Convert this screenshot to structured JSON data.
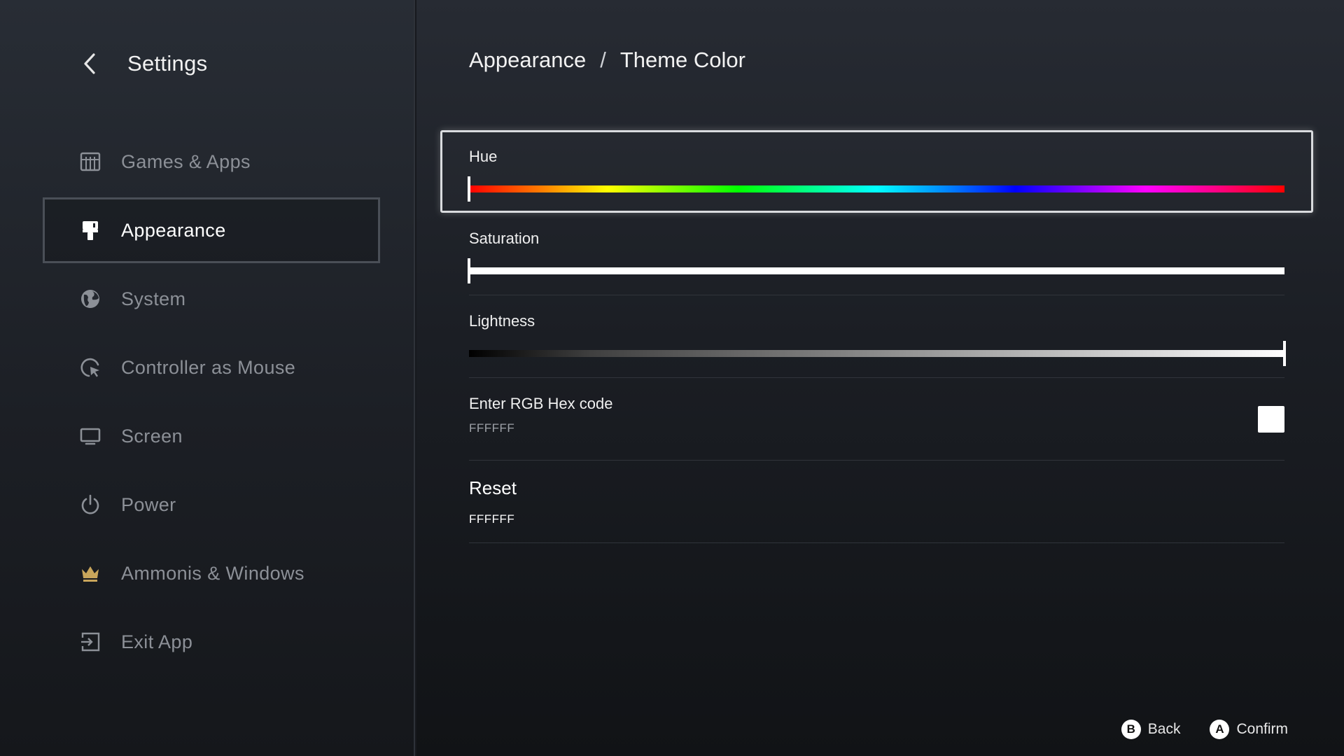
{
  "sidebar": {
    "title": "Settings",
    "back_icon": "chevron-left-icon",
    "items": [
      {
        "label": "Games  &  Apps",
        "icon": "games-grid-icon",
        "active": false
      },
      {
        "label": "Appearance",
        "icon": "paint-roller-icon",
        "active": true
      },
      {
        "label": "System",
        "icon": "globe-icon",
        "active": false
      },
      {
        "label": "Controller as Mouse",
        "icon": "cursor-icon",
        "active": false
      },
      {
        "label": "Screen",
        "icon": "monitor-icon",
        "active": false
      },
      {
        "label": "Power",
        "icon": "power-icon",
        "active": false
      },
      {
        "label": "Ammonis  &  Windows",
        "icon": "crown-icon",
        "active": false
      },
      {
        "label": "Exit App",
        "icon": "exit-icon",
        "active": false
      }
    ]
  },
  "breadcrumb": {
    "parent": "Appearance",
    "separator": "/",
    "current": "Theme Color"
  },
  "settings": {
    "hue": {
      "label": "Hue",
      "value_fraction": 0.0
    },
    "saturation": {
      "label": "Saturation",
      "value_fraction": 0.0
    },
    "lightness": {
      "label": "Lightness",
      "value_fraction": 1.0
    },
    "hex": {
      "label": "Enter RGB Hex code",
      "value": "FFFFFF",
      "swatch_color": "#FFFFFF"
    },
    "reset": {
      "label": "Reset",
      "value": "FFFFFF"
    }
  },
  "footer": {
    "back": {
      "glyph": "B",
      "label": "Back"
    },
    "confirm": {
      "glyph": "A",
      "label": "Confirm"
    }
  },
  "colors": {
    "accent_gold": "#c9a65b",
    "focus_border": "#d9dbde"
  }
}
